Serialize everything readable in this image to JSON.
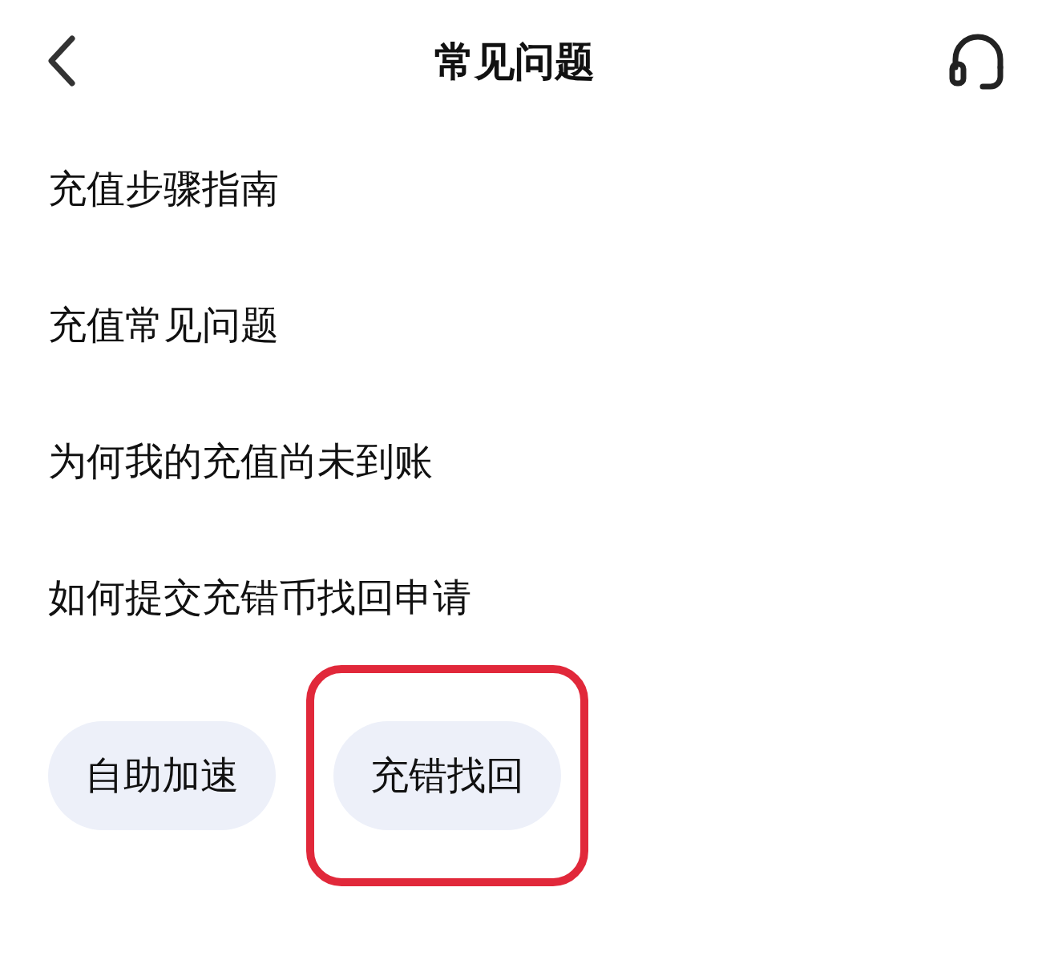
{
  "header": {
    "title": "常见问题"
  },
  "faq_items": [
    {
      "label": "充值步骤指南"
    },
    {
      "label": "充值常见问题"
    },
    {
      "label": "为何我的充值尚未到账"
    },
    {
      "label": "如何提交充错币找回申请"
    }
  ],
  "buttons": [
    {
      "label": "自助加速",
      "highlighted": false
    },
    {
      "label": "充错找回",
      "highlighted": true
    }
  ]
}
